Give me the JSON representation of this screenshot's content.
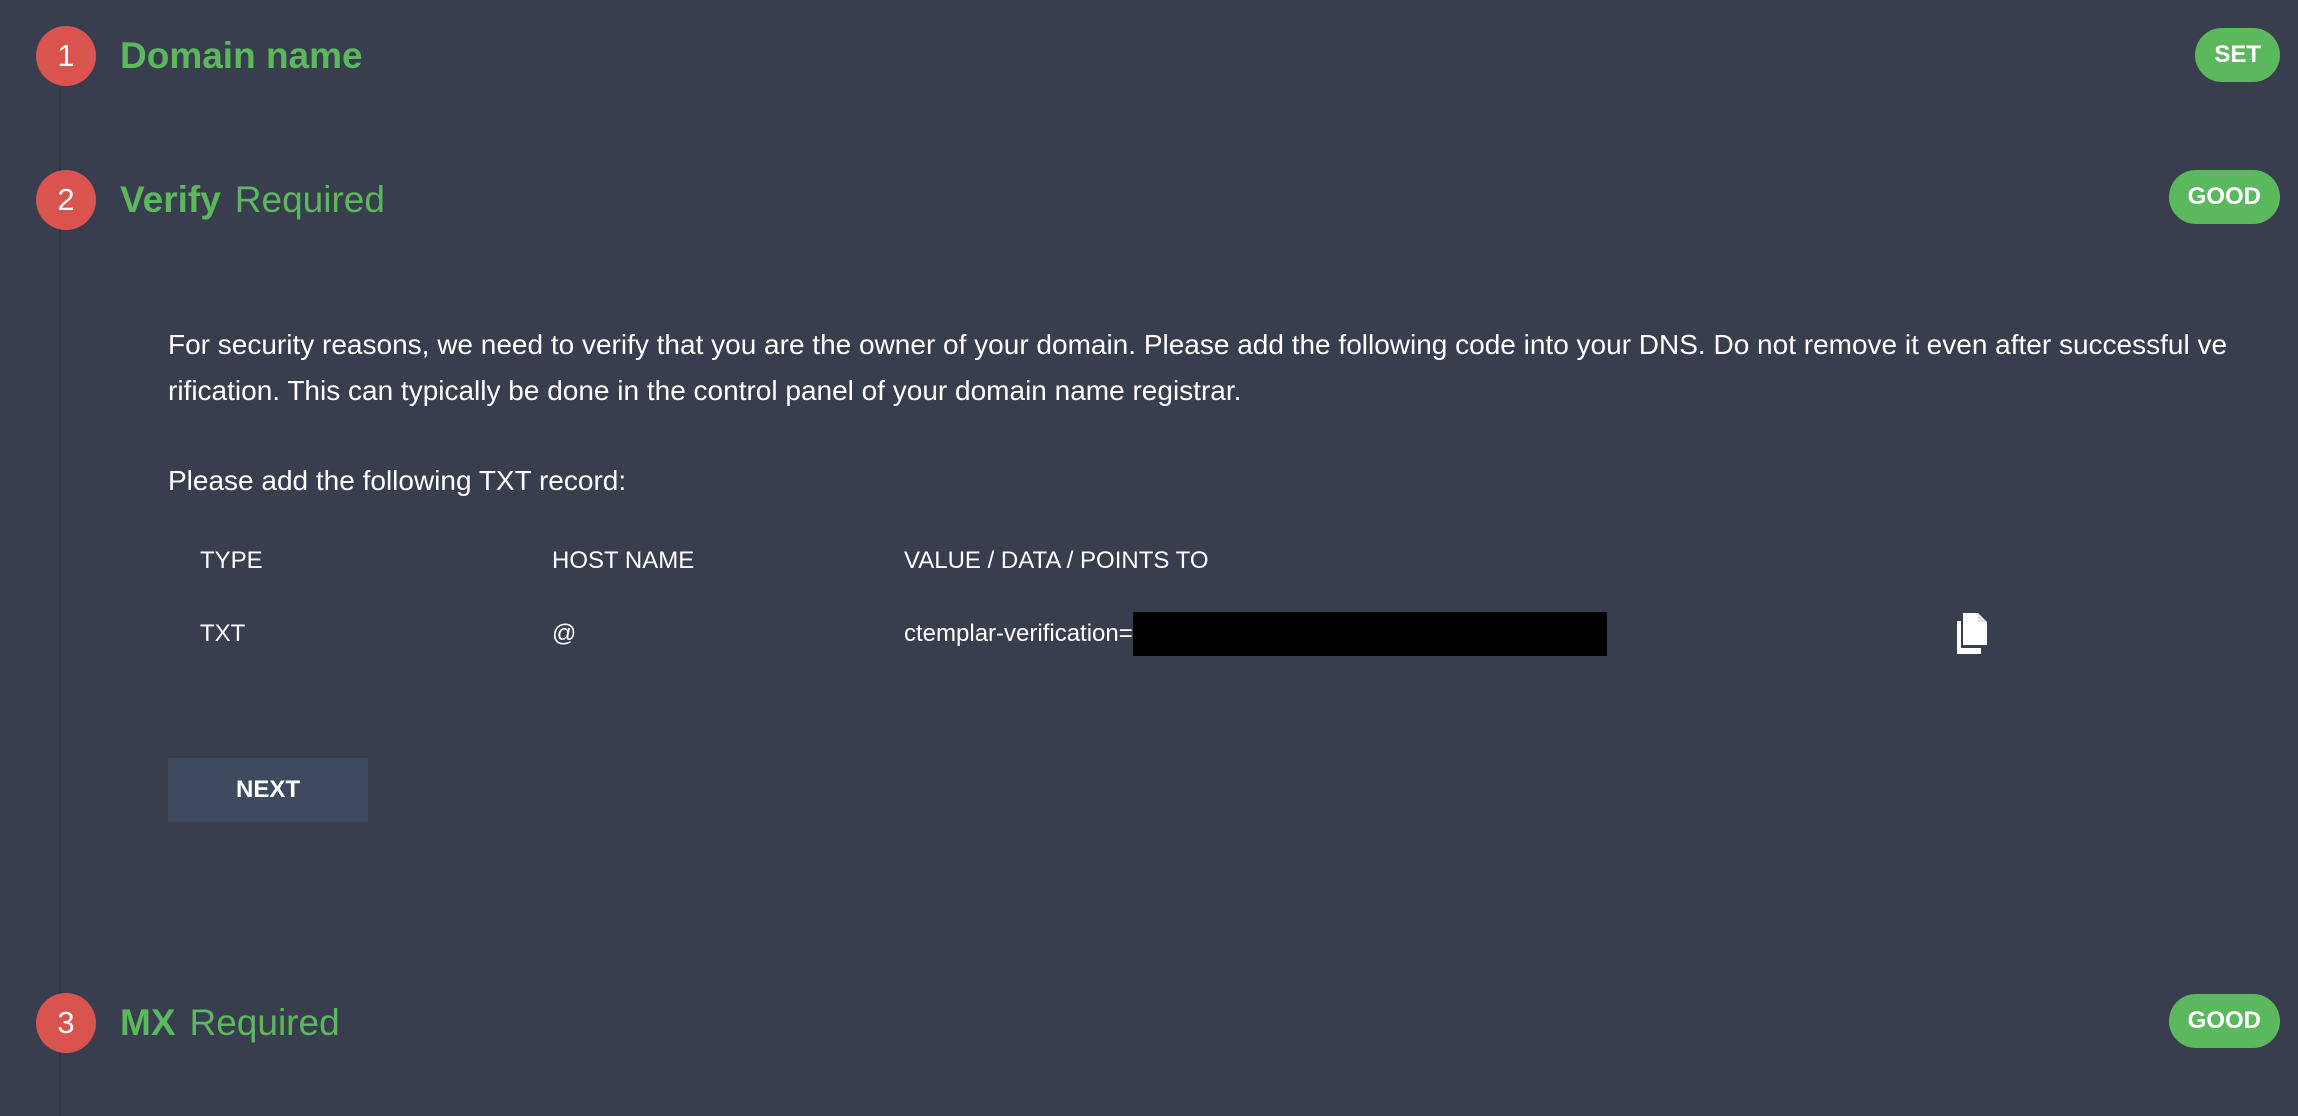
{
  "steps": [
    {
      "number": "1",
      "title": "Domain name",
      "subtitle": "",
      "status": "SET"
    },
    {
      "number": "2",
      "title": "Verify",
      "subtitle": "Required",
      "status": "GOOD"
    },
    {
      "number": "3",
      "title": "MX",
      "subtitle": "Required",
      "status": "GOOD"
    }
  ],
  "verify": {
    "description": "For security reasons, we need to verify that you are the owner of your domain. Please add the following code into your DNS. Do not remove it even after successful verification. This can typically be done in the control panel of your domain name registrar.",
    "txt_heading": "Please add the following TXT record:",
    "table": {
      "headers": [
        "TYPE",
        "HOST NAME",
        "VALUE / DATA / POINTS TO"
      ],
      "row": {
        "type": "TXT",
        "host": "@",
        "value_prefix": "ctemplar-verification="
      }
    },
    "next_label": "NEXT"
  },
  "colors": {
    "background": "#393e4f",
    "step_circle": "#d9534f",
    "accent_green": "#5cb85c",
    "button": "#3f4a5e"
  },
  "icons": {
    "copy": "copy-icon"
  }
}
